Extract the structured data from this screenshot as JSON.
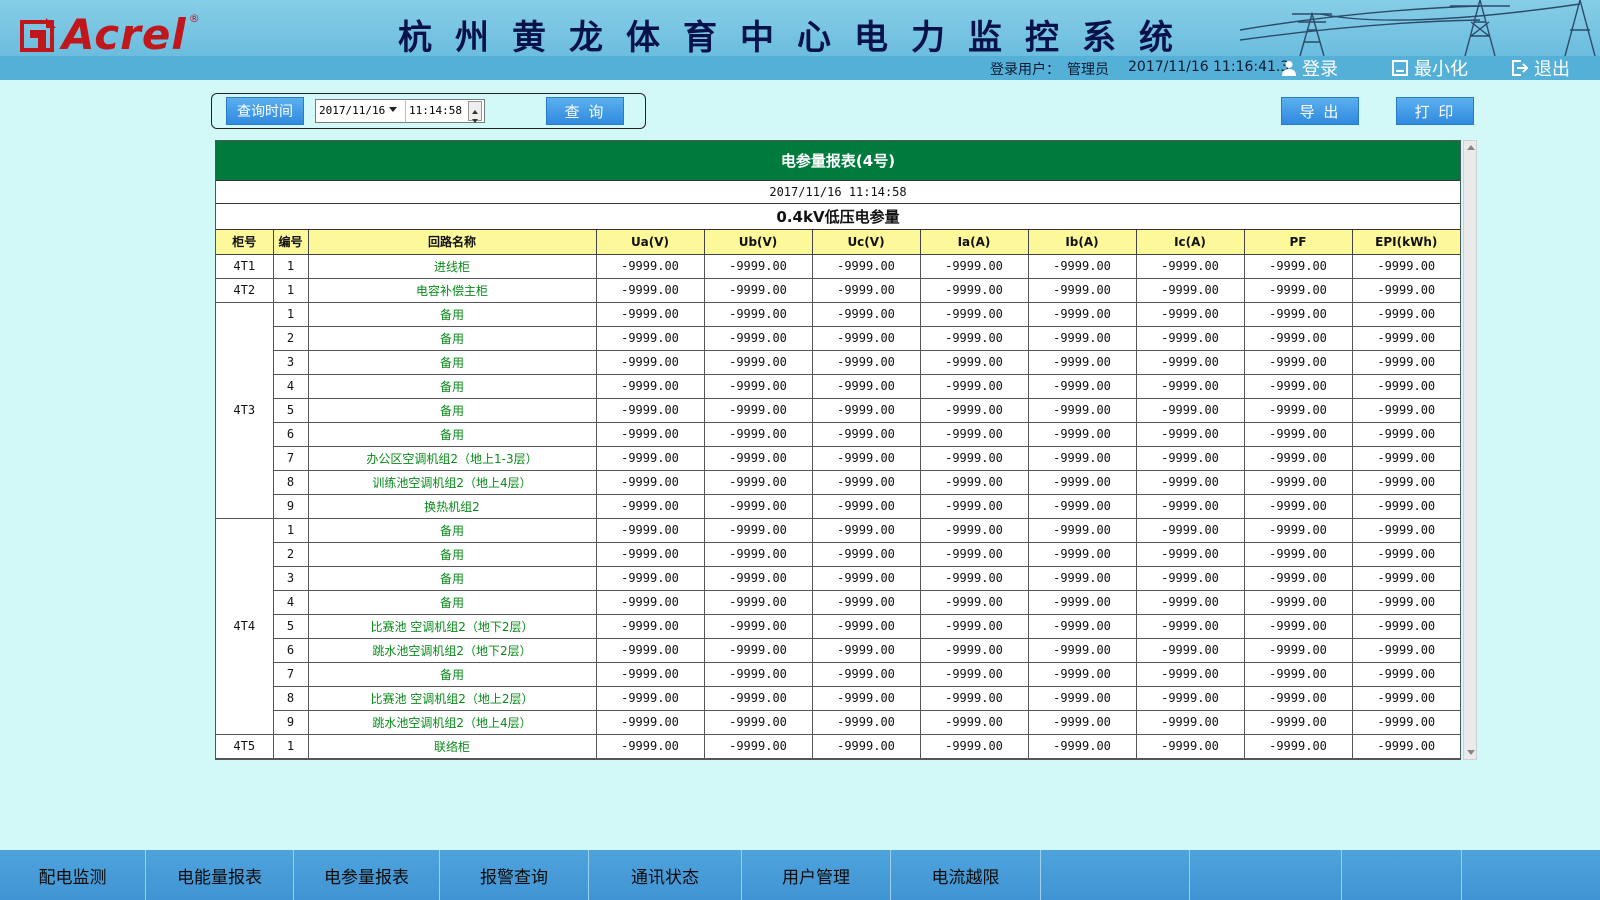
{
  "header": {
    "brand": "Acrel",
    "brand_reg": "®",
    "system_title": "杭州黄龙体育中心电力监控系统",
    "login_label": "登录用户：",
    "login_user": "管理员",
    "date": "2017/11/16",
    "time": "11:16:41.3",
    "login_button": "登录",
    "minimize_button": "最小化",
    "exit_button": "退出"
  },
  "query": {
    "time_label": "查询时间",
    "date_value": "2017/11/16",
    "time_value": "11:14:58",
    "query_button": "查 询",
    "export_button": "导 出",
    "print_button": "打 印"
  },
  "report": {
    "title": "电参量报表(4号)",
    "datetime": "2017/11/16 11:14:58",
    "subtitle": "0.4kV低压电参量",
    "columns": [
      "柜号",
      "编号",
      "回路名称",
      "Ua(V)",
      "Ub(V)",
      "Uc(V)",
      "Ia(A)",
      "Ib(A)",
      "Ic(A)",
      "PF",
      "EPI(kWh)"
    ],
    "groups": [
      {
        "cabinet": "4T1",
        "rows": [
          {
            "no": "1",
            "name": "进线柜",
            "values": [
              "-9999.00",
              "-9999.00",
              "-9999.00",
              "-9999.00",
              "-9999.00",
              "-9999.00",
              "-9999.00",
              "-9999.00"
            ]
          }
        ]
      },
      {
        "cabinet": "4T2",
        "rows": [
          {
            "no": "1",
            "name": "电容补偿主柜",
            "values": [
              "-9999.00",
              "-9999.00",
              "-9999.00",
              "-9999.00",
              "-9999.00",
              "-9999.00",
              "-9999.00",
              "-9999.00"
            ]
          }
        ]
      },
      {
        "cabinet": "4T3",
        "rows": [
          {
            "no": "1",
            "name": "备用",
            "values": [
              "-9999.00",
              "-9999.00",
              "-9999.00",
              "-9999.00",
              "-9999.00",
              "-9999.00",
              "-9999.00",
              "-9999.00"
            ]
          },
          {
            "no": "2",
            "name": "备用",
            "values": [
              "-9999.00",
              "-9999.00",
              "-9999.00",
              "-9999.00",
              "-9999.00",
              "-9999.00",
              "-9999.00",
              "-9999.00"
            ]
          },
          {
            "no": "3",
            "name": "备用",
            "values": [
              "-9999.00",
              "-9999.00",
              "-9999.00",
              "-9999.00",
              "-9999.00",
              "-9999.00",
              "-9999.00",
              "-9999.00"
            ]
          },
          {
            "no": "4",
            "name": "备用",
            "values": [
              "-9999.00",
              "-9999.00",
              "-9999.00",
              "-9999.00",
              "-9999.00",
              "-9999.00",
              "-9999.00",
              "-9999.00"
            ]
          },
          {
            "no": "5",
            "name": "备用",
            "values": [
              "-9999.00",
              "-9999.00",
              "-9999.00",
              "-9999.00",
              "-9999.00",
              "-9999.00",
              "-9999.00",
              "-9999.00"
            ]
          },
          {
            "no": "6",
            "name": "备用",
            "values": [
              "-9999.00",
              "-9999.00",
              "-9999.00",
              "-9999.00",
              "-9999.00",
              "-9999.00",
              "-9999.00",
              "-9999.00"
            ]
          },
          {
            "no": "7",
            "name": "办公区空调机组2（地上1-3层）",
            "values": [
              "-9999.00",
              "-9999.00",
              "-9999.00",
              "-9999.00",
              "-9999.00",
              "-9999.00",
              "-9999.00",
              "-9999.00"
            ]
          },
          {
            "no": "8",
            "name": "训练池空调机组2（地上4层）",
            "values": [
              "-9999.00",
              "-9999.00",
              "-9999.00",
              "-9999.00",
              "-9999.00",
              "-9999.00",
              "-9999.00",
              "-9999.00"
            ]
          },
          {
            "no": "9",
            "name": "换热机组2",
            "values": [
              "-9999.00",
              "-9999.00",
              "-9999.00",
              "-9999.00",
              "-9999.00",
              "-9999.00",
              "-9999.00",
              "-9999.00"
            ]
          }
        ]
      },
      {
        "cabinet": "4T4",
        "rows": [
          {
            "no": "1",
            "name": "备用",
            "values": [
              "-9999.00",
              "-9999.00",
              "-9999.00",
              "-9999.00",
              "-9999.00",
              "-9999.00",
              "-9999.00",
              "-9999.00"
            ]
          },
          {
            "no": "2",
            "name": "备用",
            "values": [
              "-9999.00",
              "-9999.00",
              "-9999.00",
              "-9999.00",
              "-9999.00",
              "-9999.00",
              "-9999.00",
              "-9999.00"
            ]
          },
          {
            "no": "3",
            "name": "备用",
            "values": [
              "-9999.00",
              "-9999.00",
              "-9999.00",
              "-9999.00",
              "-9999.00",
              "-9999.00",
              "-9999.00",
              "-9999.00"
            ]
          },
          {
            "no": "4",
            "name": "备用",
            "values": [
              "-9999.00",
              "-9999.00",
              "-9999.00",
              "-9999.00",
              "-9999.00",
              "-9999.00",
              "-9999.00",
              "-9999.00"
            ]
          },
          {
            "no": "5",
            "name": "比赛池 空调机组2（地下2层）",
            "values": [
              "-9999.00",
              "-9999.00",
              "-9999.00",
              "-9999.00",
              "-9999.00",
              "-9999.00",
              "-9999.00",
              "-9999.00"
            ]
          },
          {
            "no": "6",
            "name": "跳水池空调机组2（地下2层）",
            "values": [
              "-9999.00",
              "-9999.00",
              "-9999.00",
              "-9999.00",
              "-9999.00",
              "-9999.00",
              "-9999.00",
              "-9999.00"
            ]
          },
          {
            "no": "7",
            "name": "备用",
            "values": [
              "-9999.00",
              "-9999.00",
              "-9999.00",
              "-9999.00",
              "-9999.00",
              "-9999.00",
              "-9999.00",
              "-9999.00"
            ]
          },
          {
            "no": "8",
            "name": "比赛池 空调机组2（地上2层）",
            "values": [
              "-9999.00",
              "-9999.00",
              "-9999.00",
              "-9999.00",
              "-9999.00",
              "-9999.00",
              "-9999.00",
              "-9999.00"
            ]
          },
          {
            "no": "9",
            "name": "跳水池空调机组2（地上4层）",
            "values": [
              "-9999.00",
              "-9999.00",
              "-9999.00",
              "-9999.00",
              "-9999.00",
              "-9999.00",
              "-9999.00",
              "-9999.00"
            ]
          }
        ]
      },
      {
        "cabinet": "4T5",
        "rows": [
          {
            "no": "1",
            "name": "联络柜",
            "values": [
              "-9999.00",
              "-9999.00",
              "-9999.00",
              "-9999.00",
              "-9999.00",
              "-9999.00",
              "-9999.00",
              "-9999.00"
            ]
          }
        ]
      }
    ]
  },
  "nav": {
    "items": [
      "配电监测",
      "电能量报表",
      "电参量报表",
      "报警查询",
      "通讯状态",
      "用户管理",
      "电流越限",
      "",
      "",
      ""
    ]
  },
  "colors": {
    "title_bar": "#007a3d",
    "header_row": "#fdf99b",
    "circuit_name": "#0a8a1a",
    "logo_red": "#c0171c",
    "page_bg": "#d3f8f8"
  }
}
